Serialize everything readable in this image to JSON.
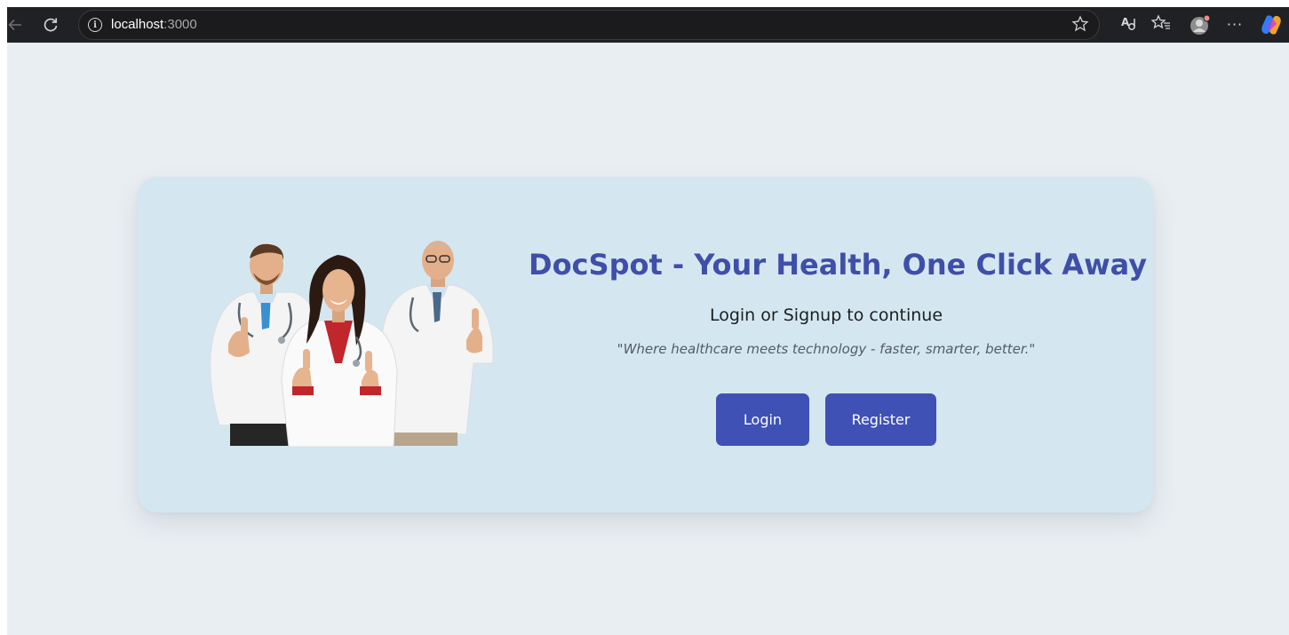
{
  "browser": {
    "url_host": "localhost",
    "url_port": ":3000",
    "icons": {
      "back": "back-arrow-icon",
      "reload": "reload-icon",
      "info": "info-icon",
      "favorite": "star-icon",
      "reading": "read-aloud-icon",
      "favorites": "favorites-icon",
      "profile": "profile-avatar-icon",
      "more": "more-icon",
      "copilot": "copilot-icon"
    },
    "more_glyph": "···"
  },
  "hero": {
    "title": "DocSpot - Your Health, One Click Away",
    "subtitle": "Login or Signup to continue",
    "tagline": "\"Where healthcare meets technology - faster, smarter, better.\"",
    "login_label": "Login",
    "register_label": "Register"
  },
  "colors": {
    "page_background": "#e9eef2",
    "card_background": "#d4e7f1",
    "accent": "#3f51b5",
    "title": "#3f4fa8"
  }
}
